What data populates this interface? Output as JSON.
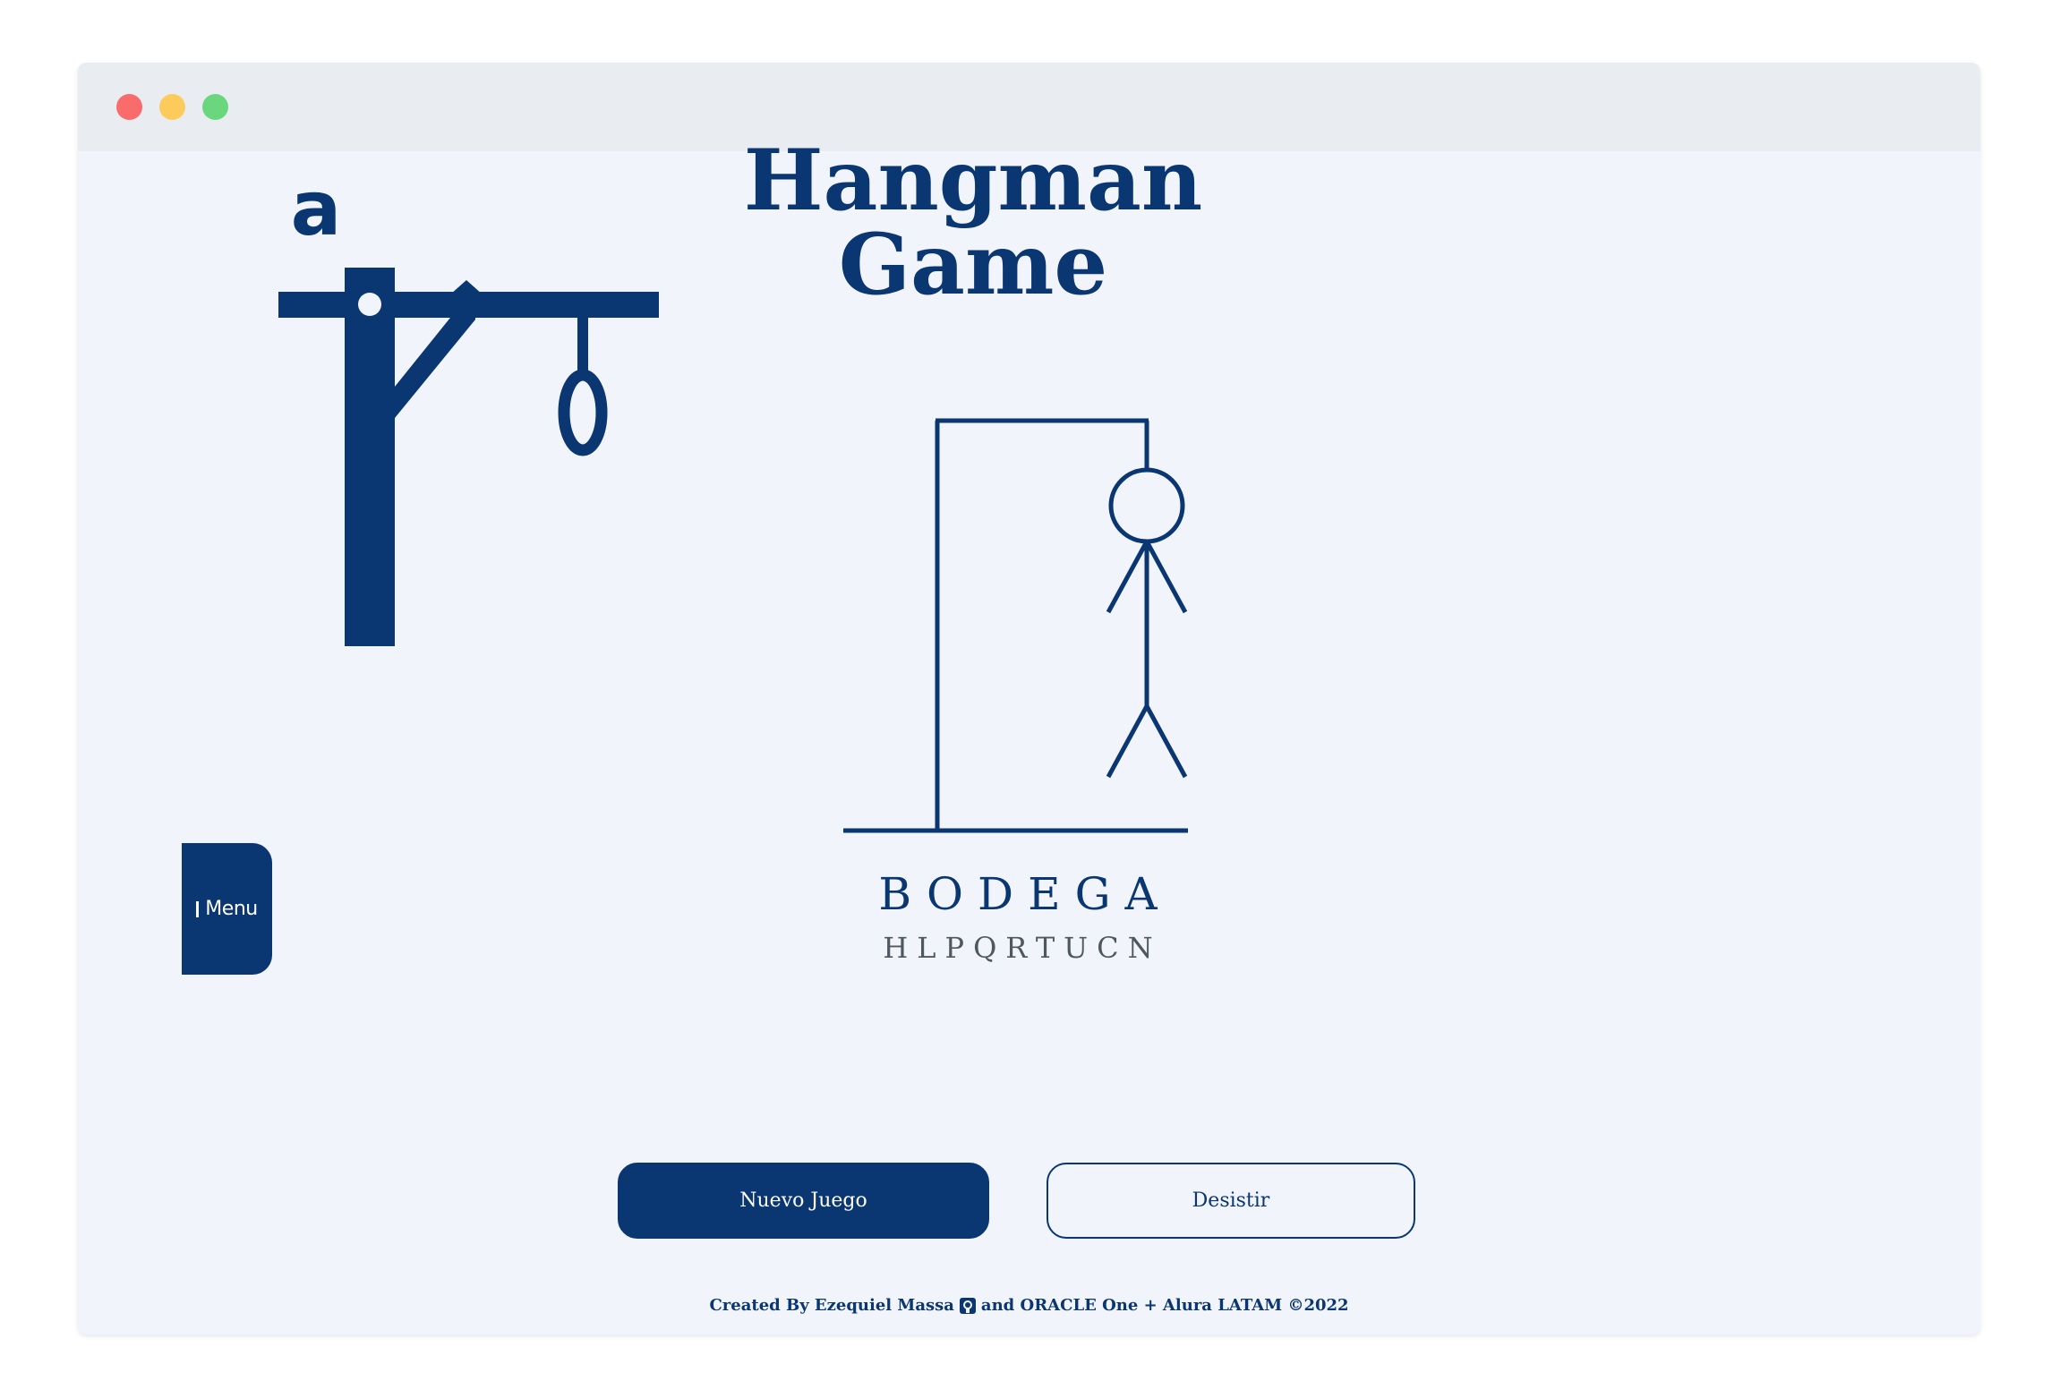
{
  "window": {
    "controls": [
      "close",
      "minimize",
      "maximize"
    ]
  },
  "header": {
    "logo_letter": "a",
    "title": "Hangman Game"
  },
  "sidebar": {
    "menu_label": "Menu"
  },
  "game": {
    "word": "BODEGA",
    "wrong_letters": "HLPQRTUCN"
  },
  "actions": {
    "new_game_label": "Nuevo Juego",
    "give_up_label": "Desistir"
  },
  "footer": {
    "credit_before": "Created By Ezequiel Massa",
    "credit_after": "and ORACLE One + Alura LATAM ©2022",
    "icon": "github-icon"
  },
  "colors": {
    "primary": "#0a3672",
    "background": "#f1f4fb",
    "titlebar": "#e9edf1",
    "wrong_letters": "#4f5860"
  }
}
